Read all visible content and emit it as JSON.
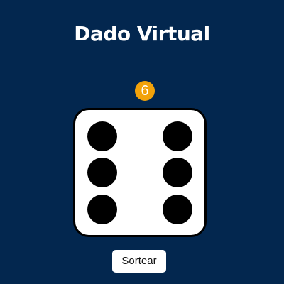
{
  "app": {
    "title": "Dado Virtual"
  },
  "result": {
    "value": "6",
    "badge_color": "#f2a20a"
  },
  "die": {
    "face": 6,
    "pips": 6
  },
  "actions": {
    "roll_label": "Sortear"
  },
  "colors": {
    "background": "#03274f",
    "die_face": "#ffffff",
    "pip": "#000000"
  }
}
